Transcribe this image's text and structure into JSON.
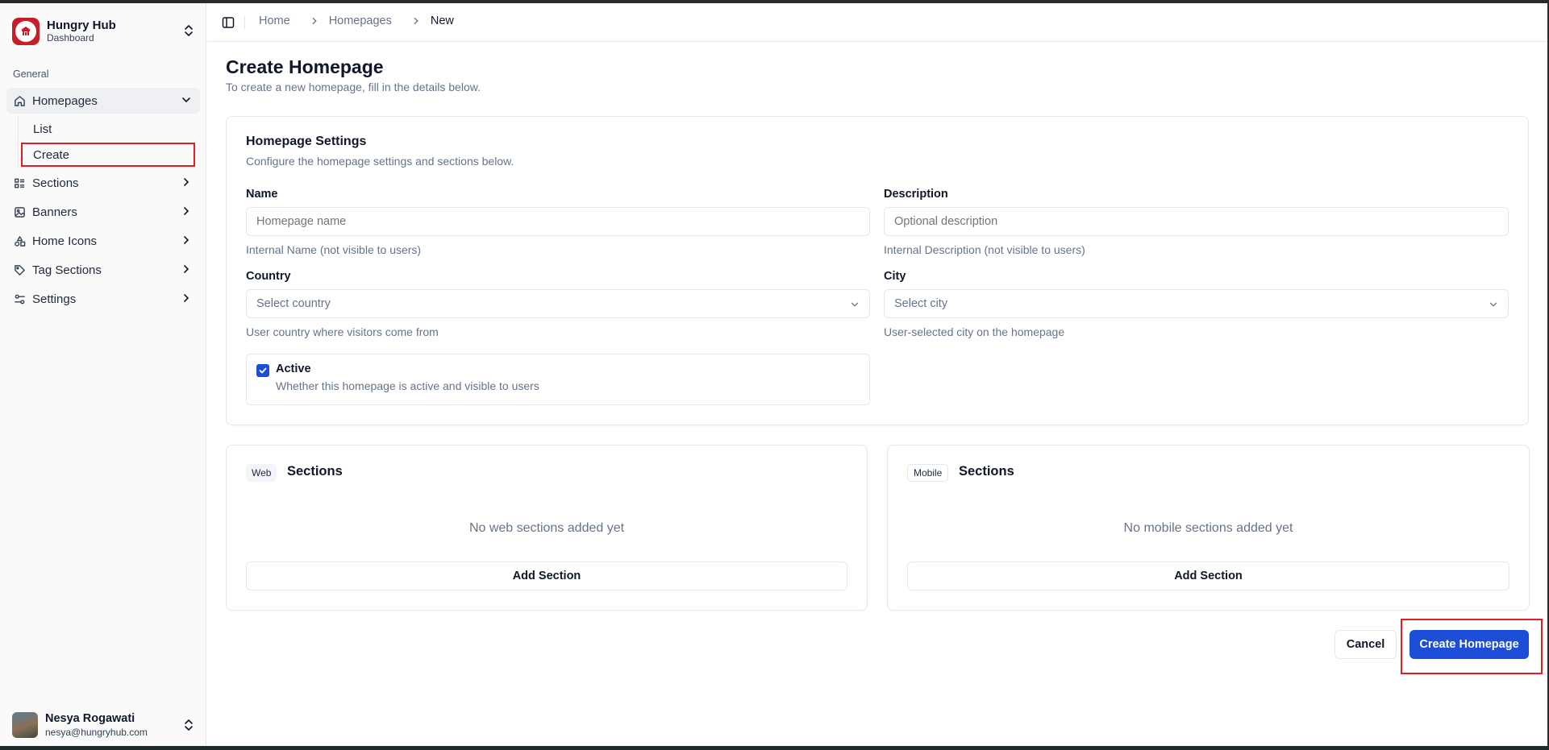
{
  "brand": {
    "title": "Hungry Hub",
    "subtitle": "Dashboard",
    "color": "#c81e2a"
  },
  "sidebar": {
    "group_label": "General",
    "homepages": {
      "label": "Homepages",
      "icon": "home-icon",
      "sub": [
        "List",
        "Create"
      ]
    },
    "items": [
      {
        "label": "Sections",
        "icon": "list-icon"
      },
      {
        "label": "Banners",
        "icon": "image-icon"
      },
      {
        "label": "Home Icons",
        "icon": "shapes-icon"
      },
      {
        "label": "Tag Sections",
        "icon": "tag-icon"
      },
      {
        "label": "Settings",
        "icon": "sliders-icon"
      }
    ]
  },
  "user": {
    "name": "Nesya Rogawati",
    "email": "nesya@hungryhub.com"
  },
  "breadcrumb": {
    "home": "Home",
    "homepages": "Homepages",
    "current": "New"
  },
  "page": {
    "title": "Create Homepage",
    "subtitle": "To create a new homepage, fill in the details below."
  },
  "settings": {
    "title": "Homepage Settings",
    "description": "Configure the homepage settings and sections below.",
    "name": {
      "label": "Name",
      "value": "",
      "placeholder": "Homepage name",
      "hint": "Internal Name (not visible to users)"
    },
    "desc": {
      "label": "Description",
      "value": "",
      "placeholder": "Optional description",
      "hint": "Internal Description (not visible to users)"
    },
    "country": {
      "label": "Country",
      "placeholder": "Select country",
      "hint": "User country where visitors come from"
    },
    "city": {
      "label": "City",
      "placeholder": "Select city",
      "hint": "User-selected city on the homepage"
    },
    "active": {
      "label": "Active",
      "description": "Whether this homepage is active and visible to users",
      "checked": true
    }
  },
  "web_sections": {
    "badge": "Web",
    "title": "Sections",
    "empty": "No web sections added yet",
    "add": "Add Section"
  },
  "mobile_sections": {
    "badge": "Mobile",
    "title": "Sections",
    "empty": "No mobile sections added yet",
    "add": "Add Section"
  },
  "actions": {
    "cancel": "Cancel",
    "create": "Create Homepage",
    "accent": "#1d4ed8"
  }
}
